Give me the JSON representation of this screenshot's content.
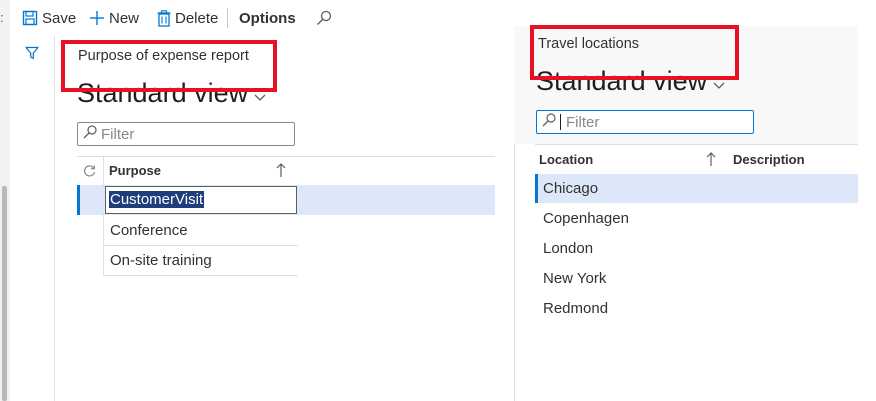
{
  "toolbar": {
    "save_label": "Save",
    "new_label": "New",
    "delete_label": "Delete",
    "options_label": "Options"
  },
  "purpose_pane": {
    "caption": "Purpose of expense report",
    "view_title": "Standard view",
    "filter_placeholder": "Filter",
    "column_header": "Purpose",
    "rows": [
      "CustomerVisit",
      "Conference",
      "On-site training"
    ]
  },
  "locations_pane": {
    "caption": "Travel locations",
    "view_title": "Standard view",
    "filter_placeholder": "Filter",
    "column_location": "Location",
    "column_description": "Description",
    "rows": [
      "Chicago",
      "Copenhagen",
      "London",
      "New York",
      "Redmond"
    ]
  },
  "colors": {
    "accent": "#0078d4",
    "selected_row": "#dce8fa",
    "highlight_box": "#e81123",
    "selection_text_bg": "#1f3d7a"
  },
  "icons": [
    "save-icon",
    "add-icon",
    "delete-icon",
    "search-icon",
    "filter-icon",
    "refresh-icon",
    "sort-ascending-icon",
    "chevron-down-icon"
  ]
}
